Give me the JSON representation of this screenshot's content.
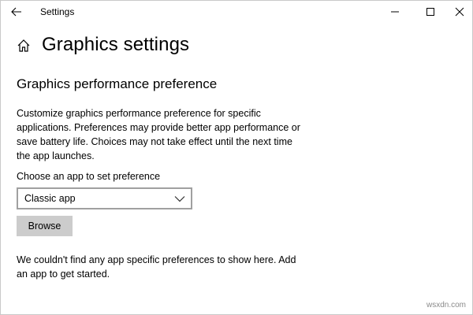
{
  "window": {
    "title": "Settings",
    "back_icon": "back-arrow-icon",
    "minimize_icon": "minimize-icon",
    "maximize_icon": "maximize-icon",
    "close_icon": "close-icon"
  },
  "header": {
    "home_icon": "home-icon",
    "title": "Graphics settings"
  },
  "section": {
    "title": "Graphics performance preference",
    "description": "Customize graphics performance preference for specific applications. Preferences may provide better app performance or save battery life. Choices may not take effect until the next time the app launches."
  },
  "app_picker": {
    "label": "Choose an app to set preference",
    "selected": "Classic app",
    "chevron_icon": "chevron-down-icon",
    "browse_label": "Browse"
  },
  "empty_state": {
    "message": "We couldn't find any app specific preferences to show here. Add an app to get started."
  },
  "watermark": "wsxdn.com",
  "colors": {
    "background": "#ffffff",
    "button_bg": "#cccccc",
    "select_border": "#a0a0a0",
    "text": "#000000"
  }
}
